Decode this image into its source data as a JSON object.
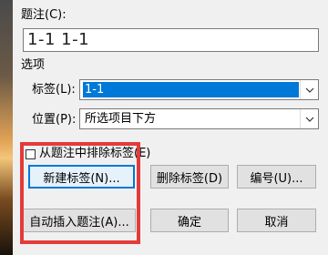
{
  "caption_label": "题注(C):",
  "caption_value": "1-1 1-1",
  "options_label": "选项",
  "label_field": {
    "label": "标签(L):",
    "value": "1-1"
  },
  "position_field": {
    "label": "位置(P):",
    "value": "所选项目下方"
  },
  "exclude_checkbox": {
    "label": "从题注中排除标签(E)",
    "checked": false
  },
  "buttons": {
    "new_label": "新建标签(N)...",
    "delete_label": "删除标签(D)",
    "numbering": "编号(U)...",
    "auto_caption": "自动插入题注(A)...",
    "ok": "确定",
    "cancel": "取消"
  },
  "colors": {
    "highlight": "#0078d7",
    "annotation": "#e23b3b"
  }
}
